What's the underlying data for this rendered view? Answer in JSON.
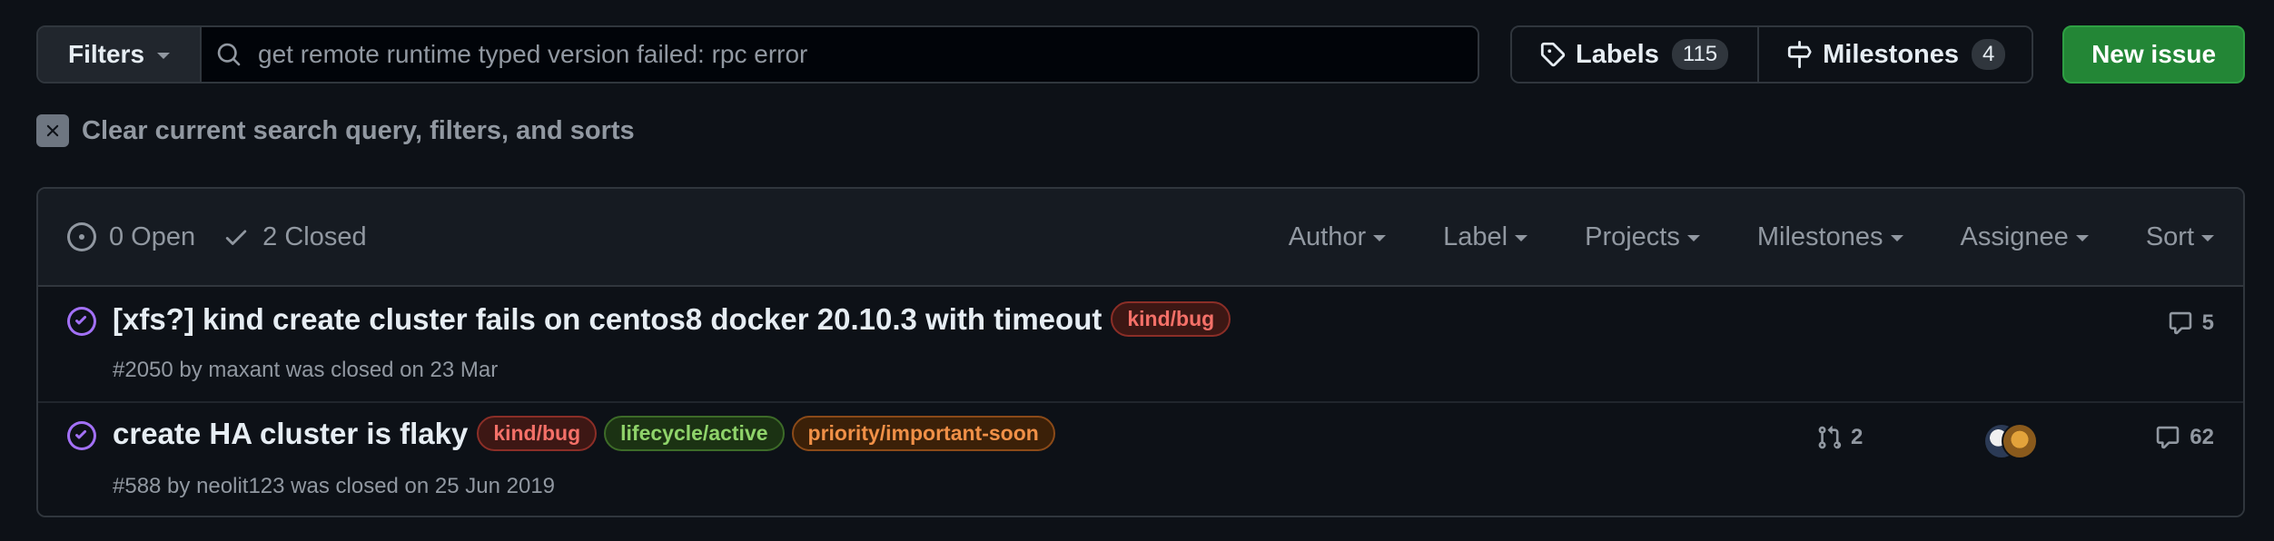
{
  "search": {
    "filters_label": "Filters",
    "query": "get remote runtime typed version failed: rpc error"
  },
  "labels_btn": {
    "label": "Labels",
    "count": "115"
  },
  "milestones_btn": {
    "label": "Milestones",
    "count": "4"
  },
  "new_issue_label": "New issue",
  "clear_text": "Clear current search query, filters, and sorts",
  "header": {
    "open_label": "0 Open",
    "closed_label": "2 Closed",
    "sorters": [
      "Author",
      "Label",
      "Projects",
      "Milestones",
      "Assignee",
      "Sort"
    ]
  },
  "issues": [
    {
      "title": "[xfs?] kind create cluster fails on centos8 docker 20.10.3 with timeout",
      "labels": [
        {
          "name": "kind/bug",
          "color": "#f47068",
          "bg": "#3d1714",
          "border": "#8b2e27"
        }
      ],
      "meta": "#2050 by maxant was closed on 23 Mar",
      "comments": "5"
    },
    {
      "title": "create HA cluster is flaky",
      "labels": [
        {
          "name": "kind/bug",
          "color": "#f47068",
          "bg": "#3d1714",
          "border": "#8b2e27"
        },
        {
          "name": "lifecycle/active",
          "color": "#8fd36a",
          "bg": "#1b3213",
          "border": "#3d6b28"
        },
        {
          "name": "priority/important-soon",
          "color": "#f09047",
          "bg": "#3b2008",
          "border": "#8b4a18"
        }
      ],
      "meta": "#588 by neolit123 was closed on 25 Jun 2019",
      "linked_prs": "2",
      "comments": "62"
    }
  ],
  "colors": {
    "closed_icon": "#a371f7",
    "accent_green": "#238636"
  }
}
